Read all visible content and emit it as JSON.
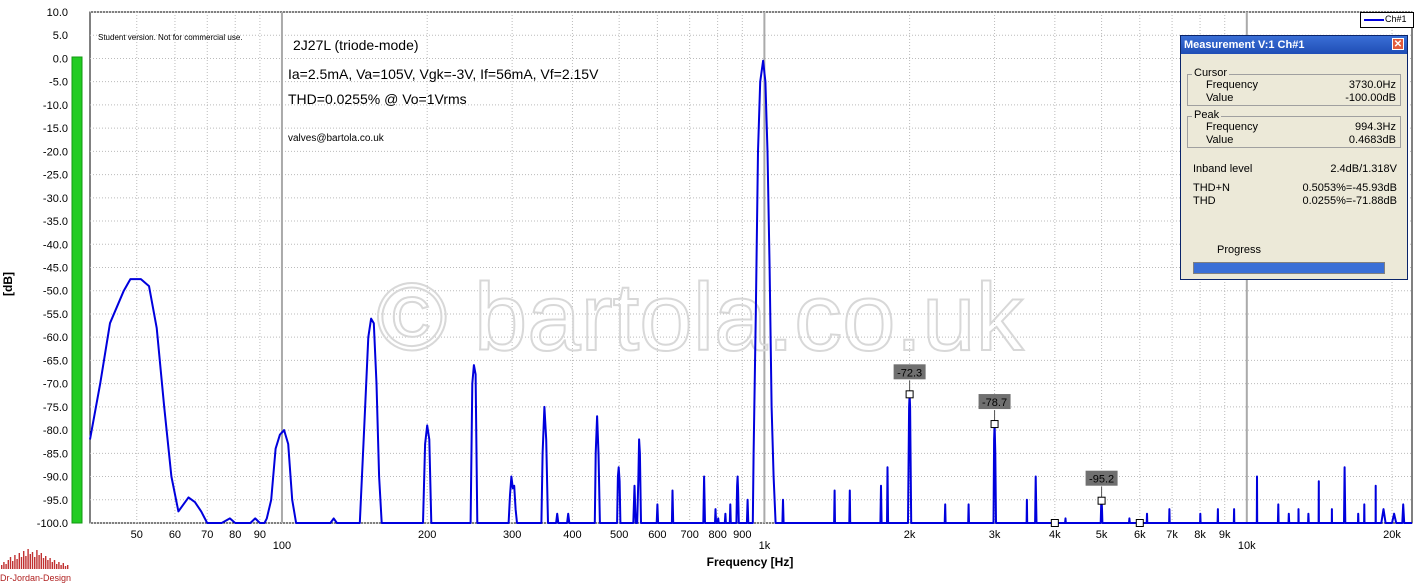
{
  "chart_data": {
    "type": "line",
    "xscale": "log",
    "xlim": [
      40,
      22000
    ],
    "ylim": [
      -100,
      10
    ],
    "xlabel": "Frequency [Hz]",
    "ylabel": "[dB]",
    "yticks": [
      "10.0",
      "5.0",
      "0.0",
      "-5.0",
      "-10.0",
      "-15.0",
      "-20.0",
      "-25.0",
      "-30.0",
      "-35.0",
      "-40.0",
      "-45.0",
      "-50.0",
      "-55.0",
      "-60.0",
      "-65.0",
      "-70.0",
      "-75.0",
      "-80.0",
      "-85.0",
      "-90.0",
      "-95.0",
      "-100.0"
    ],
    "xticks": [
      {
        "v": 50,
        "t": "50"
      },
      {
        "v": 60,
        "t": "60"
      },
      {
        "v": 70,
        "t": "70"
      },
      {
        "v": 80,
        "t": "80"
      },
      {
        "v": 90,
        "t": "90"
      },
      {
        "v": 100,
        "t": "100"
      },
      {
        "v": 200,
        "t": "200"
      },
      {
        "v": 300,
        "t": "300"
      },
      {
        "v": 400,
        "t": "400"
      },
      {
        "v": 500,
        "t": "500"
      },
      {
        "v": 600,
        "t": "600"
      },
      {
        "v": 700,
        "t": "700"
      },
      {
        "v": 800,
        "t": "800"
      },
      {
        "v": 900,
        "t": "900"
      },
      {
        "v": 1000,
        "t": "1k"
      },
      {
        "v": 2000,
        "t": "2k"
      },
      {
        "v": 3000,
        "t": "3k"
      },
      {
        "v": 4000,
        "t": "4k"
      },
      {
        "v": 5000,
        "t": "5k"
      },
      {
        "v": 6000,
        "t": "6k"
      },
      {
        "v": 7000,
        "t": "7k"
      },
      {
        "v": 8000,
        "t": "8k"
      },
      {
        "v": 9000,
        "t": "9k"
      },
      {
        "v": 10000,
        "t": "10k"
      },
      {
        "v": 20000,
        "t": "20k"
      }
    ],
    "series": [
      {
        "name": "Ch#1",
        "color": "#0000dd",
        "points": [
          [
            40,
            -82
          ],
          [
            42,
            -70
          ],
          [
            44,
            -57
          ],
          [
            47,
            -50
          ],
          [
            48.5,
            -47.5
          ],
          [
            51,
            -47.5
          ],
          [
            53,
            -49
          ],
          [
            55,
            -58
          ],
          [
            57,
            -75
          ],
          [
            59,
            -90
          ],
          [
            61,
            -97.5
          ],
          [
            64,
            -94.5
          ],
          [
            66,
            -95.5
          ],
          [
            68,
            -97.5
          ],
          [
            70,
            -100
          ],
          [
            72,
            -100
          ],
          [
            75,
            -100
          ],
          [
            78,
            -99
          ],
          [
            80,
            -100
          ],
          [
            86,
            -100
          ],
          [
            88,
            -99
          ],
          [
            90,
            -100
          ],
          [
            92,
            -100
          ],
          [
            93,
            -99
          ],
          [
            95,
            -95
          ],
          [
            97,
            -84
          ],
          [
            99,
            -81
          ],
          [
            101,
            -80
          ],
          [
            103,
            -83
          ],
          [
            105,
            -95
          ],
          [
            107,
            -100
          ],
          [
            126,
            -100
          ],
          [
            128,
            -99
          ],
          [
            130,
            -100
          ],
          [
            145,
            -100
          ],
          [
            148,
            -80
          ],
          [
            151,
            -60
          ],
          [
            153,
            -56
          ],
          [
            155,
            -57
          ],
          [
            157,
            -70
          ],
          [
            159,
            -90
          ],
          [
            161,
            -100
          ],
          [
            196,
            -100
          ],
          [
            198,
            -83
          ],
          [
            200,
            -79
          ],
          [
            202,
            -82
          ],
          [
            204,
            -100
          ],
          [
            246,
            -100
          ],
          [
            248,
            -70
          ],
          [
            250,
            -66
          ],
          [
            252,
            -68
          ],
          [
            254,
            -100
          ],
          [
            295,
            -100
          ],
          [
            297,
            -94
          ],
          [
            299,
            -90
          ],
          [
            301,
            -92.5
          ],
          [
            303,
            -92
          ],
          [
            305,
            -97
          ],
          [
            307,
            -100
          ],
          [
            345,
            -100
          ],
          [
            347,
            -85
          ],
          [
            350,
            -75
          ],
          [
            353,
            -82
          ],
          [
            356,
            -100
          ],
          [
            370,
            -100
          ],
          [
            372,
            -98
          ],
          [
            374,
            -100
          ],
          [
            390,
            -100
          ],
          [
            392,
            -98
          ],
          [
            394,
            -100
          ],
          [
            445,
            -100
          ],
          [
            447,
            -85
          ],
          [
            450,
            -77
          ],
          [
            453,
            -85
          ],
          [
            456,
            -100
          ],
          [
            495,
            -100
          ],
          [
            497,
            -90
          ],
          [
            499,
            -88
          ],
          [
            501,
            -91
          ],
          [
            503,
            -100
          ],
          [
            535,
            -100
          ],
          [
            538,
            -92
          ],
          [
            541,
            -100
          ],
          [
            545,
            -100
          ],
          [
            548,
            -90
          ],
          [
            550,
            -82
          ],
          [
            552,
            -85
          ],
          [
            555,
            -100
          ],
          [
            598,
            -100
          ],
          [
            600,
            -96
          ],
          [
            602,
            -100
          ],
          [
            643,
            -100
          ],
          [
            645,
            -93
          ],
          [
            647,
            -100
          ],
          [
            747,
            -100
          ],
          [
            750,
            -90
          ],
          [
            753,
            -100
          ],
          [
            790,
            -100
          ],
          [
            792,
            -97
          ],
          [
            794,
            -100
          ],
          [
            800,
            -100
          ],
          [
            802,
            -99
          ],
          [
            804,
            -100
          ],
          [
            828,
            -100
          ],
          [
            830,
            -98
          ],
          [
            832,
            -100
          ],
          [
            848,
            -100
          ],
          [
            850,
            -96
          ],
          [
            852,
            -100
          ],
          [
            875,
            -100
          ],
          [
            878,
            -92
          ],
          [
            880,
            -90
          ],
          [
            882,
            -93
          ],
          [
            885,
            -100
          ],
          [
            920,
            -100
          ],
          [
            923,
            -95
          ],
          [
            926,
            -100
          ],
          [
            946,
            -100
          ],
          [
            950,
            -85
          ],
          [
            960,
            -55
          ],
          [
            970,
            -20
          ],
          [
            980,
            -5
          ],
          [
            994,
            -0.5
          ],
          [
            1005,
            -5
          ],
          [
            1015,
            -20
          ],
          [
            1025,
            -45
          ],
          [
            1035,
            -75
          ],
          [
            1045,
            -90
          ],
          [
            1055,
            -100
          ],
          [
            1090,
            -100
          ],
          [
            1093,
            -95
          ],
          [
            1096,
            -100
          ],
          [
            1395,
            -100
          ],
          [
            1398,
            -93
          ],
          [
            1401,
            -100
          ],
          [
            1500,
            -100
          ],
          [
            1503,
            -93
          ],
          [
            1506,
            -100
          ],
          [
            1740,
            -100
          ],
          [
            1745,
            -92
          ],
          [
            1750,
            -100
          ],
          [
            1795,
            -100
          ],
          [
            1800,
            -88
          ],
          [
            1805,
            -100
          ],
          [
            1985,
            -100
          ],
          [
            1995,
            -75
          ],
          [
            2000,
            -72.3
          ],
          [
            2005,
            -75
          ],
          [
            2015,
            -100
          ],
          [
            2365,
            -100
          ],
          [
            2370,
            -96
          ],
          [
            2375,
            -100
          ],
          [
            2645,
            -100
          ],
          [
            2650,
            -96
          ],
          [
            2655,
            -100
          ],
          [
            2985,
            -100
          ],
          [
            2993,
            -82
          ],
          [
            3000,
            -78.7
          ],
          [
            3010,
            -85
          ],
          [
            3020,
            -100
          ],
          [
            3495,
            -100
          ],
          [
            3500,
            -95
          ],
          [
            3505,
            -100
          ],
          [
            3640,
            -100
          ],
          [
            3650,
            -90
          ],
          [
            3665,
            -100
          ],
          [
            3990,
            -100
          ],
          [
            4000,
            -100
          ],
          [
            4200,
            -100
          ],
          [
            4208,
            -99
          ],
          [
            4215,
            -100
          ],
          [
            4980,
            -100
          ],
          [
            4990,
            -96
          ],
          [
            5000,
            -95.2
          ],
          [
            5010,
            -97
          ],
          [
            5020,
            -100
          ],
          [
            5700,
            -100
          ],
          [
            5710,
            -99
          ],
          [
            5720,
            -100
          ],
          [
            6000,
            -100
          ],
          [
            6200,
            -100
          ],
          [
            6210,
            -98
          ],
          [
            6220,
            -100
          ],
          [
            6900,
            -100
          ],
          [
            6910,
            -97
          ],
          [
            6920,
            -100
          ],
          [
            8000,
            -100
          ],
          [
            8010,
            -98
          ],
          [
            8020,
            -100
          ],
          [
            8700,
            -100
          ],
          [
            8710,
            -97
          ],
          [
            8720,
            -100
          ],
          [
            9400,
            -100
          ],
          [
            9410,
            -97
          ],
          [
            9420,
            -100
          ],
          [
            10490,
            -100
          ],
          [
            10500,
            -90
          ],
          [
            10510,
            -100
          ],
          [
            11600,
            -100
          ],
          [
            11620,
            -96
          ],
          [
            11640,
            -100
          ],
          [
            12200,
            -100
          ],
          [
            12220,
            -98
          ],
          [
            12240,
            -100
          ],
          [
            12790,
            -100
          ],
          [
            12800,
            -97
          ],
          [
            12810,
            -100
          ],
          [
            13400,
            -100
          ],
          [
            13420,
            -98
          ],
          [
            13440,
            -100
          ],
          [
            14090,
            -100
          ],
          [
            14100,
            -91
          ],
          [
            14110,
            -100
          ],
          [
            15000,
            -100
          ],
          [
            15010,
            -97
          ],
          [
            15020,
            -100
          ],
          [
            15900,
            -100
          ],
          [
            15950,
            -88
          ],
          [
            16000,
            -100
          ],
          [
            17000,
            -100
          ],
          [
            17020,
            -98
          ],
          [
            17040,
            -100
          ],
          [
            17500,
            -100
          ],
          [
            17520,
            -96
          ],
          [
            17540,
            -100
          ],
          [
            18490,
            -100
          ],
          [
            18500,
            -92
          ],
          [
            18510,
            -100
          ],
          [
            19000,
            -100
          ],
          [
            19200,
            -97
          ],
          [
            19400,
            -100
          ],
          [
            20000,
            -100
          ],
          [
            20200,
            -98
          ],
          [
            20400,
            -100
          ],
          [
            21000,
            -100
          ],
          [
            21100,
            -96
          ],
          [
            21200,
            -100
          ],
          [
            22000,
            -100
          ]
        ]
      }
    ],
    "markers": [
      {
        "x": 2000,
        "y": -72.3,
        "label": "-72.3"
      },
      {
        "x": 3000,
        "y": -78.7,
        "label": "-78.7"
      },
      {
        "x": 4000,
        "y": -100,
        "label": ""
      },
      {
        "x": 5000,
        "y": -95.2,
        "label": "-95.2"
      },
      {
        "x": 6000,
        "y": -100,
        "label": ""
      }
    ],
    "annotations": {
      "student": "Student version. Not for commercial use.",
      "tube": "2J27L (triode-mode)",
      "conditions": "Ia=2.5mA, Va=105V, Vgk=-3V, If=56mA, Vf=2.15V",
      "thd": "THD=0.0255% @ Vo=1Vrms",
      "email": "valves@bartola.co.uk",
      "watermark": "© bartola.co.uk",
      "logo": "Dr-Jordan-Design"
    },
    "legend": "top-right",
    "grid": true
  },
  "measurement": {
    "title": "Measurement V:1 Ch#1",
    "cursor": {
      "label": "Cursor",
      "frequency_label": "Frequency",
      "frequency": "3730.0Hz",
      "value_label": "Value",
      "value": "-100.00dB"
    },
    "peak": {
      "label": "Peak",
      "frequency_label": "Frequency",
      "frequency": "994.3Hz",
      "value_label": "Value",
      "value": "0.4683dB"
    },
    "inband_label": "Inband level",
    "inband": "2.4dB/1.318V",
    "thdn_label": "THD+N",
    "thdn": "0.5053%=-45.93dB",
    "thd_label": "THD",
    "thd": "0.0255%=-71.88dB",
    "progress_label": "Progress",
    "progress": 1.0
  },
  "colors": {
    "trace": "#0000dd",
    "level_meter": "#22cc22",
    "window_title": "#1f4db5"
  }
}
